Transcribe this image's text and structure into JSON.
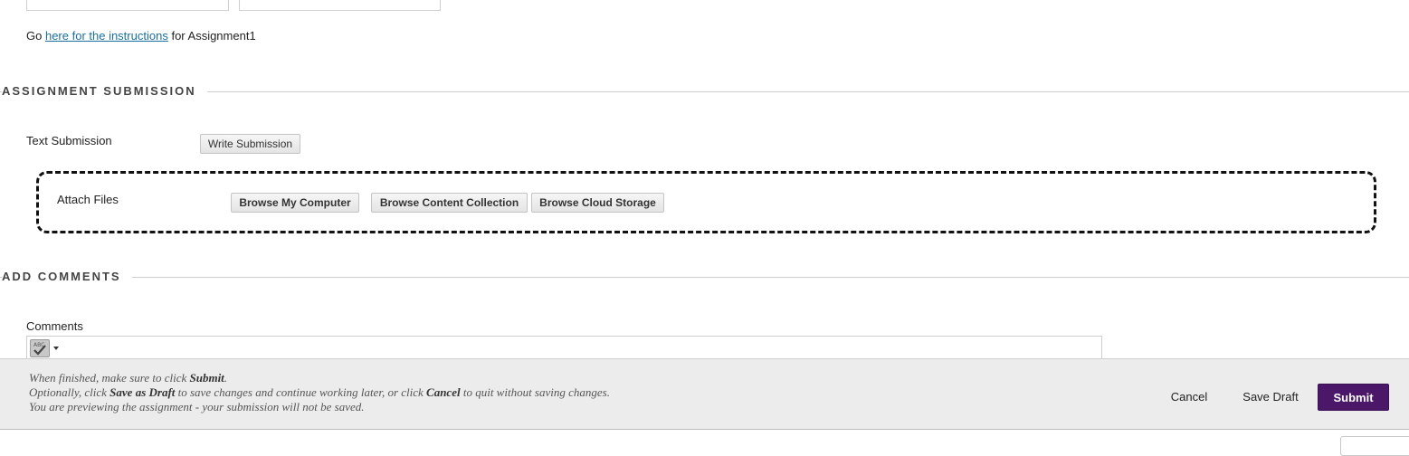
{
  "instructions": {
    "prefix": "Go",
    "link_text": "here for the instructions",
    "suffix": "for Assignment1"
  },
  "assignment_submission": {
    "heading": "ASSIGNMENT SUBMISSION",
    "text_submission_label": "Text Submission",
    "write_submission_button": "Write Submission",
    "attach_files_label": "Attach Files",
    "browse_my_computer": "Browse My Computer",
    "browse_content_collection": "Browse Content Collection",
    "browse_cloud_storage": "Browse Cloud Storage"
  },
  "add_comments": {
    "heading": "ADD COMMENTS",
    "comments_label": "Comments",
    "spellcheck_icon": "spellcheck-icon"
  },
  "footer": {
    "line1_pre": "When finished, make sure to click ",
    "line1_bold": "Submit",
    "line1_post": ".",
    "line2_pre": "Optionally, click ",
    "line2_bold1": "Save as Draft",
    "line2_mid": " to save changes and continue working later, or click ",
    "line2_bold2": "Cancel",
    "line2_post": " to quit without saving changes.",
    "line3": "You are previewing the assignment - your submission will not be saved.",
    "cancel_button": "Cancel",
    "save_draft_button": "Save Draft",
    "submit_button": "Submit"
  },
  "colors": {
    "submit_bg": "#4b1869",
    "link": "#1a6fa0",
    "footer_bg": "#ececec"
  }
}
